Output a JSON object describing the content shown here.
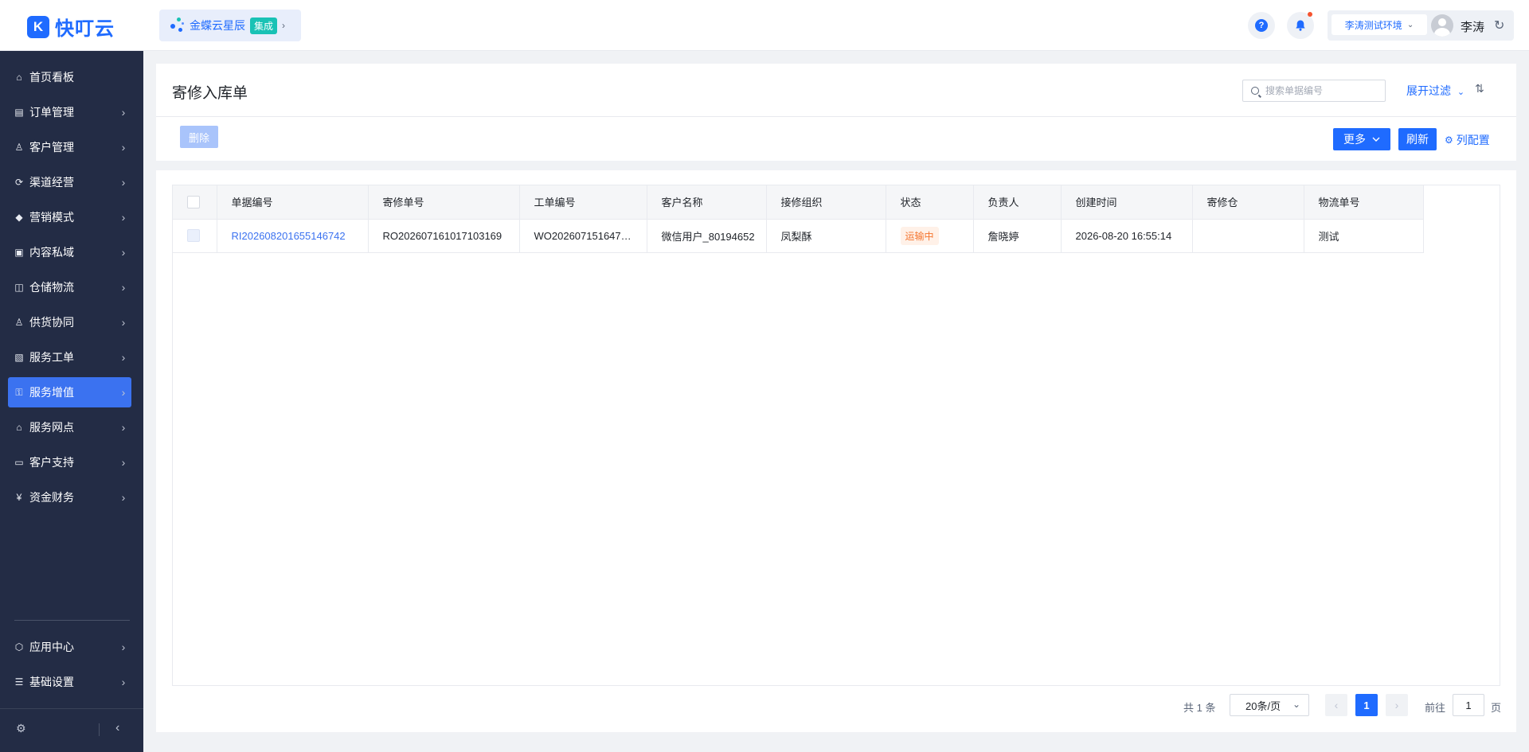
{
  "app": {
    "logo_mark": "K",
    "logo_text": "快叮云"
  },
  "integration": {
    "name": "金蝶云星辰",
    "badge": "集成"
  },
  "header": {
    "help_icon": "question-circle-icon",
    "bell_icon": "bell-icon",
    "env_label": "李涛测试环境",
    "user_name": "李涛",
    "refresh_icon": "refresh-icon"
  },
  "sidebar": {
    "items": [
      {
        "label": "首页看板",
        "icon": "⌂",
        "chevron": false,
        "active": false
      },
      {
        "label": "订单管理",
        "icon": "▤",
        "chevron": true,
        "active": false
      },
      {
        "label": "客户管理",
        "icon": "♙",
        "chevron": true,
        "active": false
      },
      {
        "label": "渠道经营",
        "icon": "⟳",
        "chevron": true,
        "active": false
      },
      {
        "label": "营销模式",
        "icon": "◆",
        "chevron": true,
        "active": false
      },
      {
        "label": "内容私域",
        "icon": "▣",
        "chevron": true,
        "active": false
      },
      {
        "label": "仓储物流",
        "icon": "◫",
        "chevron": true,
        "active": false
      },
      {
        "label": "供货协同",
        "icon": "♙",
        "chevron": true,
        "active": false
      },
      {
        "label": "服务工单",
        "icon": "▧",
        "chevron": true,
        "active": false
      },
      {
        "label": "服务增值",
        "icon": "⚿",
        "chevron": true,
        "active": true
      },
      {
        "label": "服务网点",
        "icon": "⌂",
        "chevron": true,
        "active": false
      },
      {
        "label": "客户支持",
        "icon": "▭",
        "chevron": true,
        "active": false
      },
      {
        "label": "资金财务",
        "icon": "¥",
        "chevron": true,
        "active": false
      }
    ],
    "bottom_items": [
      {
        "label": "应用中心",
        "icon": "⬡",
        "chevron": true
      },
      {
        "label": "基础设置",
        "icon": "☰",
        "chevron": true
      }
    ]
  },
  "page": {
    "title": "寄修入库单",
    "search_placeholder": "搜索单据编号",
    "expand_filter": "展开过滤",
    "delete_label": "删除",
    "more_label": "更多",
    "refresh_label": "刷新",
    "column_config_label": "列配置"
  },
  "table": {
    "columns": [
      "单据编号",
      "寄修单号",
      "工单编号",
      "客户名称",
      "接修组织",
      "状态",
      "负责人",
      "创建时间",
      "寄修仓",
      "物流单号"
    ],
    "rows": [
      {
        "doc_no": "RI202608201655146742",
        "repair_no": "RO202607161017103169",
        "work_order_no": "WO202607151647…",
        "customer": "微信用户_80194652",
        "org": "凤梨酥",
        "status": "运输中",
        "owner": "詹晓婷",
        "created": "2026-08-20 16:55:14",
        "warehouse": "",
        "logistics_no": "测试"
      }
    ]
  },
  "pagination": {
    "total_text": "共 1 条",
    "page_size": "20条/页",
    "current_page": "1",
    "goto_label": "前往",
    "goto_value": "1",
    "page_suffix": "页"
  },
  "colors": {
    "primary": "#1f6bff",
    "sidebar_bg": "#232c45",
    "active_nav": "#3b72f0",
    "status_tag": "#f5752f"
  }
}
